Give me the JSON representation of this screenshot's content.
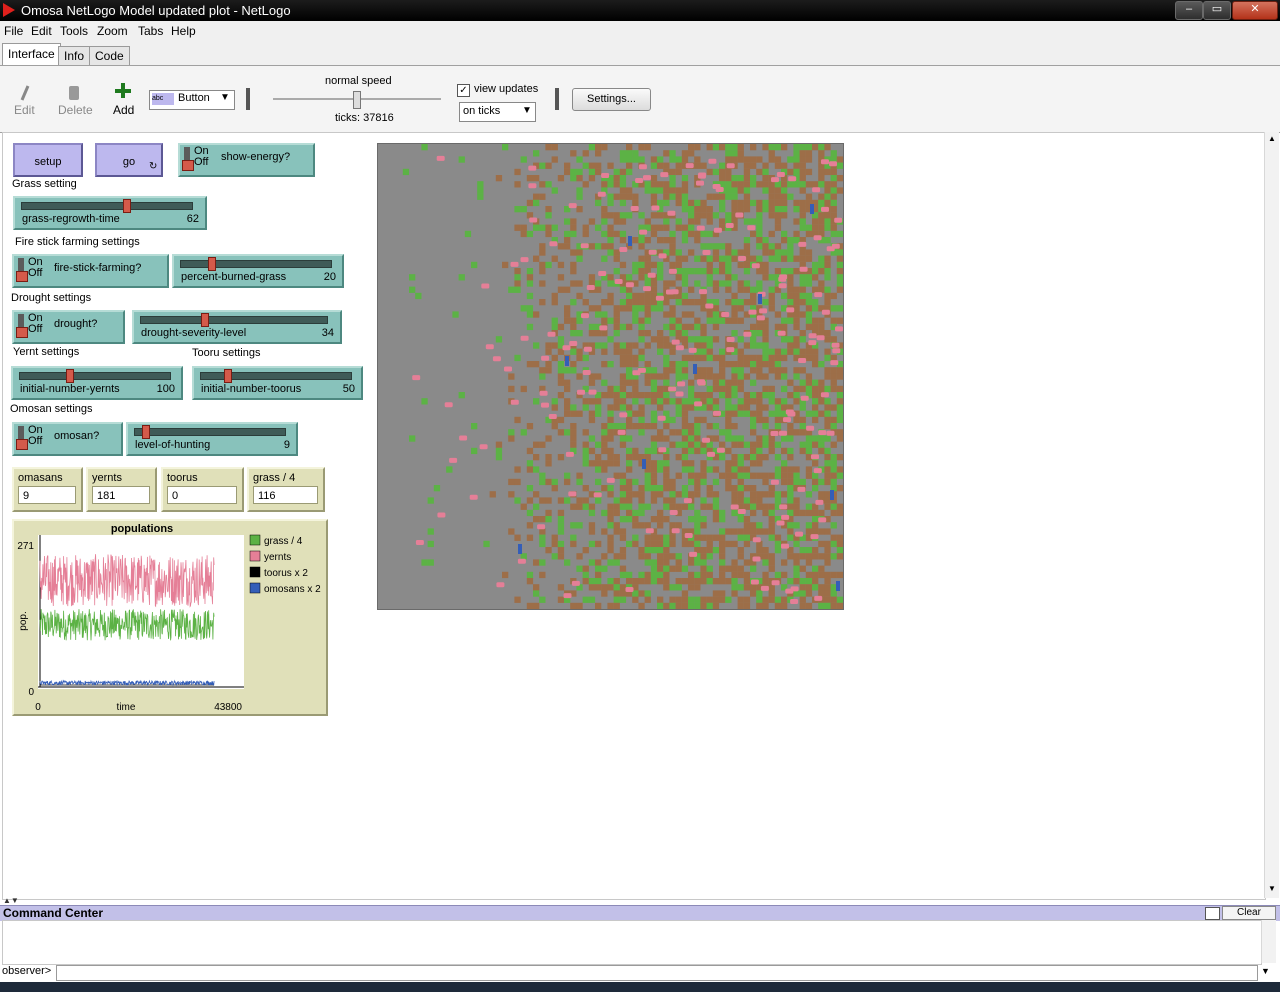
{
  "window": {
    "title": "Omosa NetLogo Model updated plot - NetLogo",
    "controls": [
      "–",
      "▭",
      "✕"
    ]
  },
  "menu": [
    "File",
    "Edit",
    "Tools",
    "Zoom",
    "Tabs",
    "Help"
  ],
  "tabs": [
    "Interface",
    "Info",
    "Code"
  ],
  "toolbar": {
    "edit": "Edit",
    "delete": "Delete",
    "add": "Add",
    "widget_type": "Button",
    "speed_label": "normal speed",
    "ticks": "ticks: 37816",
    "view_updates": "view updates",
    "view_updates_checked": true,
    "update_mode": "on ticks",
    "settings": "Settings..."
  },
  "widgets": {
    "setup": "setup",
    "go": "go",
    "show_energy": {
      "on": "On",
      "off": "Off",
      "label": "show-energy?"
    },
    "grass_setting": "Grass setting",
    "grass_regrowth": {
      "name": "grass-regrowth-time",
      "value": "62",
      "fraction": 0.62
    },
    "fire_settings": "Fire stick farming settings",
    "fire_switch": {
      "on": "On",
      "off": "Off",
      "label": "fire-stick-farming?"
    },
    "percent_burned": {
      "name": "percent-burned-grass",
      "value": "20",
      "fraction": 0.2
    },
    "drought_settings": "Drought settings",
    "drought_switch": {
      "on": "On",
      "off": "Off",
      "label": "drought?"
    },
    "drought_level": {
      "name": "drought-severity-level",
      "value": "34",
      "fraction": 0.34
    },
    "yernt_settings": "Yernt settings",
    "yernts_slider": {
      "name": "initial-number-yernts",
      "value": "100",
      "fraction": 0.33
    },
    "tooru_settings": "Tooru settings",
    "toorus_slider": {
      "name": "initial-number-toorus",
      "value": "50",
      "fraction": 0.17
    },
    "omosan_settings": "Omosan settings",
    "omosan_switch": {
      "on": "On",
      "off": "Off",
      "label": "omosan?"
    },
    "hunting": {
      "name": "level-of-hunting",
      "value": "9",
      "fraction": 0.06
    }
  },
  "monitors": [
    {
      "name": "omasans",
      "value": "9"
    },
    {
      "name": "yernts",
      "value": "181"
    },
    {
      "name": "toorus",
      "value": "0"
    },
    {
      "name": "grass / 4",
      "value": "116"
    }
  ],
  "chart_data": {
    "type": "line",
    "title": "populations",
    "xlabel": "time",
    "ylabel": "pop.",
    "xlim": [
      0,
      43800
    ],
    "ylim": [
      0,
      271
    ],
    "x_ticks": [
      "0",
      "43800"
    ],
    "y_ticks": [
      "0",
      "271"
    ],
    "legend_position": "right",
    "series": [
      {
        "name": "grass / 4",
        "color": "#5cb245",
        "approx_range": [
          85,
          145
        ],
        "approx_mean": 115
      },
      {
        "name": "yernts",
        "color": "#e57f97",
        "approx_range": [
          150,
          250
        ],
        "approx_mean": 200
      },
      {
        "name": "toorus x 2",
        "color": "#000000",
        "approx_range": [
          0,
          0
        ],
        "approx_mean": 0
      },
      {
        "name": "omosans x 2",
        "color": "#345eb8",
        "approx_range": [
          0,
          8
        ],
        "approx_mean": 4
      }
    ]
  },
  "world": {
    "colors": {
      "grey": "#8a8a8a",
      "green": "#5cb245",
      "brown": "#9d6e48",
      "pink": "#e57f97",
      "blue": "#345eb8"
    }
  },
  "command_center": {
    "title": "Command Center",
    "clear": "Clear",
    "prompt": "observer>"
  }
}
